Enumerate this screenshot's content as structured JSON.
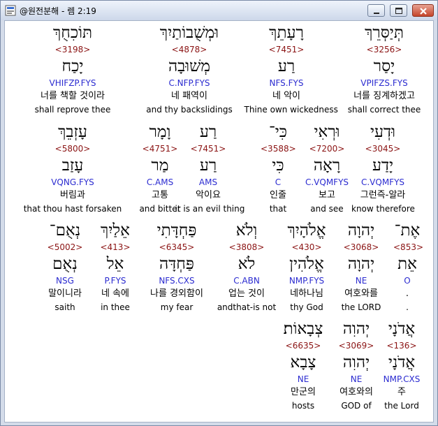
{
  "window": {
    "title": "@원전분해 - 렘 2:19"
  },
  "colors": {
    "strong_number": "#8b1414",
    "morph_code": "#2b2bd0",
    "text": "#000000"
  },
  "rows": [
    [
      {
        "word": "תּוֹכִחֻךְ",
        "strong": "<3198>",
        "lemma": "יָכַח",
        "morph": "VHIFZP.FYS",
        "korean": "너를 책할 것이라",
        "english": "shall reprove thee"
      },
      {
        "word": "וּמְשֻׁבוֹתַיִךְ",
        "strong": "<4878>",
        "lemma": "מְשׁוּבָה",
        "morph": "C.NFP.FYS",
        "korean": "네 패역이",
        "english": "and thy backslidings"
      },
      {
        "word": "רָעָתֵךְ",
        "strong": "<7451>",
        "lemma": "רַע",
        "morph": "NFS.FYS",
        "korean": "네 악이",
        "english": "Thine own wickedness"
      },
      {
        "word": "תְּיַסְּרֵךְ",
        "strong": "<3256>",
        "lemma": "יָסַר",
        "morph": "VPIFZS.FYS",
        "korean": "너를 징계하겠고",
        "english": "shall correct thee"
      }
    ],
    [
      {
        "word": "עָזְבֵךְ",
        "strong": "<5800>",
        "lemma": "עָזַב",
        "morph": "VQNG.FYS",
        "korean": "버림과",
        "english": "that thou hast forsaken"
      },
      {
        "word": "וָמָר",
        "strong": "<4751>",
        "lemma": "מַר",
        "morph": "C.AMS",
        "korean": "고통",
        "english": "and bitter"
      },
      {
        "word": "רַע",
        "strong": "<7451>",
        "lemma": "רַע",
        "morph": "AMS",
        "korean": "악이요",
        "english": "it is an evil thing"
      },
      {
        "word": "כִּי־",
        "strong": "<3588>",
        "lemma": "כִּי",
        "morph": "C",
        "korean": "인줄",
        "english": "that"
      },
      {
        "word": "וּרְאִי",
        "strong": "<7200>",
        "lemma": "רָאָה",
        "morph": "C.VQMFYS",
        "korean": "보고",
        "english": "and see"
      },
      {
        "word": "וּדְעִי",
        "strong": "<3045>",
        "lemma": "יָדַע",
        "morph": "C.VQMFYS",
        "korean": "그런즉-알라",
        "english": "know therefore"
      }
    ],
    [
      {
        "word": "נְאֻם־",
        "strong": "<5002>",
        "lemma": "נְאֻם",
        "morph": "NSG",
        "korean": "말이니라",
        "english": "saith"
      },
      {
        "word": "אֵלַיִךְ",
        "strong": "<413>",
        "lemma": "אֵל",
        "morph": "P.FYS",
        "korean": "네 속에",
        "english": "in thee"
      },
      {
        "word": "פַּחְדָּתִי",
        "strong": "<6345>",
        "lemma": "פַּחְדָּה",
        "morph": "NFS.CXS",
        "korean": "나를 경외함이",
        "english": "my fear"
      },
      {
        "word": "וְלֹא",
        "strong": "<3808>",
        "lemma": "לֹא",
        "morph": "C.ABN",
        "korean": "업는 것이",
        "english": "andthat-is not"
      },
      {
        "word": "אֱלֹהָיִךְ",
        "strong": "<430>",
        "lemma": "אֱלֹהִין",
        "morph": "NMP.FYS",
        "korean": "네하나님",
        "english": "thy God"
      },
      {
        "word": "יְהוָה",
        "strong": "<3068>",
        "lemma": "יְהוָה",
        "morph": "NE",
        "korean": "여호와를",
        "english": "the LORD"
      },
      {
        "word": "אֶת־",
        "strong": "<853>",
        "lemma": "אֵת",
        "morph": "O",
        "korean": ".",
        "english": "."
      }
    ],
    [
      {
        "word": "צְבָאוֹת׃",
        "strong": "<6635>",
        "lemma": "צָבָא",
        "morph": "NE",
        "korean": "만군의",
        "english": "hosts"
      },
      {
        "word": "יְהוִה",
        "strong": "<3069>",
        "lemma": "יְהוִה",
        "morph": "NE",
        "korean": "여호와의",
        "english": "GOD of"
      },
      {
        "word": "אֲדֹנָי",
        "strong": "<136>",
        "lemma": "אֲדֹנָי",
        "morph": "NMP.CXS",
        "korean": "주",
        "english": "the Lord"
      }
    ]
  ]
}
